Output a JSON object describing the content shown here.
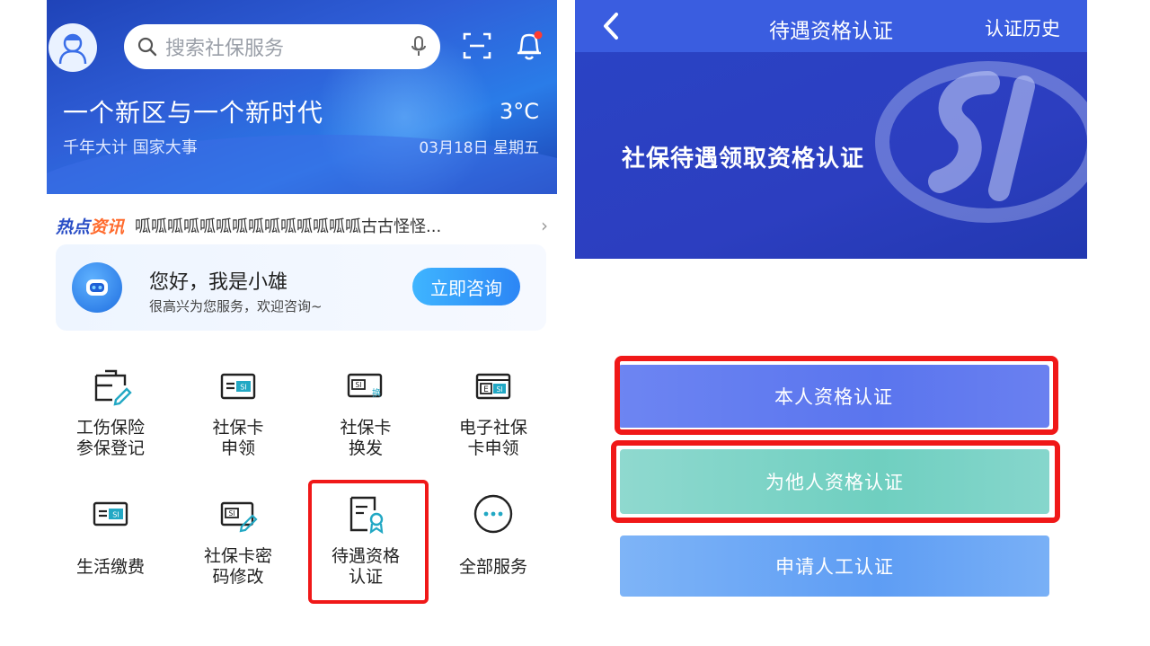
{
  "left": {
    "search": {
      "placeholder": "搜索社保服务"
    },
    "hero": {
      "title": "一个新区与一个新时代",
      "subtitle": "千年大计 国家大事",
      "temperature": "3°C",
      "date": "03月18日 星期五"
    },
    "news": {
      "tag_part1": "热点",
      "tag_part2": "资讯",
      "ticker": "呱呱呱呱呱呱呱呱呱呱呱呱呱呱古古怪怪...",
      "arrow": "›"
    },
    "assistant": {
      "title": "您好，我是小雄",
      "subtitle": "很高兴为您服务，欢迎咨询~",
      "button": "立即咨询"
    },
    "services": [
      {
        "line1": "工伤保险",
        "line2": "参保登记",
        "icon": "work-injury-insurance-icon"
      },
      {
        "line1": "社保卡",
        "line2": "申领",
        "icon": "social-security-card-icon"
      },
      {
        "line1": "社保卡",
        "line2": "换发",
        "icon": "card-replace-icon"
      },
      {
        "line1": "电子社保",
        "line2": "卡申领",
        "icon": "e-social-card-icon"
      },
      {
        "line1": "生活缴费",
        "line2": "",
        "icon": "payment-card-icon"
      },
      {
        "line1": "社保卡密",
        "line2": "码修改",
        "icon": "card-password-icon"
      },
      {
        "line1": "待遇资格",
        "line2": "认证",
        "icon": "qualification-certificate-icon"
      },
      {
        "line1": "全部服务",
        "line2": "",
        "icon": "more-services-icon"
      }
    ],
    "icon_texts": {
      "si": "SI",
      "esi": "E SI",
      "huan": "换"
    }
  },
  "right": {
    "topbar": {
      "title": "待遇资格认证",
      "history": "认证历史"
    },
    "banner": {
      "title": "社保待遇领取资格认证"
    },
    "buttons": {
      "self": "本人资格认证",
      "others": "为他人资格认证",
      "manual": "申请人工认证"
    }
  },
  "colors": {
    "primary": "#3a5de0",
    "highlight_red": "#f01818",
    "teal_button": "#6fcfc0",
    "light_blue_button": "#5e9df4"
  }
}
